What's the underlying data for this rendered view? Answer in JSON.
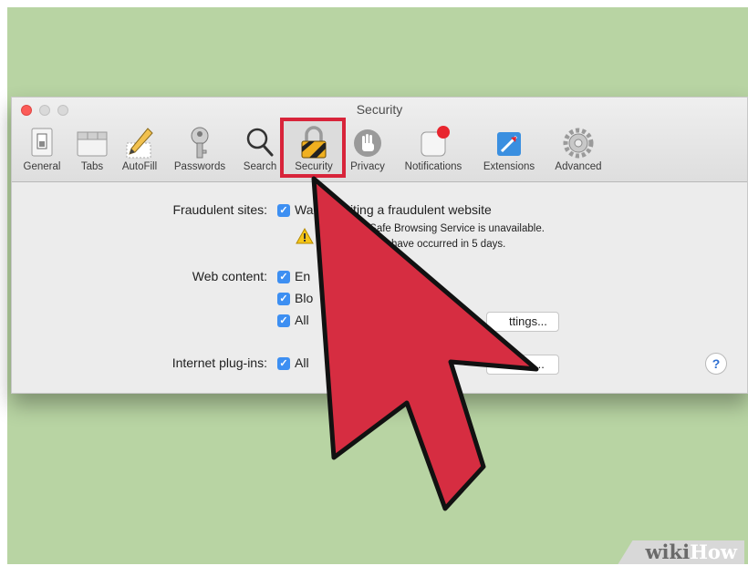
{
  "window": {
    "title": "Security"
  },
  "toolbar": {
    "items": [
      {
        "label": "General",
        "icon": "general-switch-icon"
      },
      {
        "label": "Tabs",
        "icon": "tabs-icon"
      },
      {
        "label": "AutoFill",
        "icon": "pencil-icon"
      },
      {
        "label": "Passwords",
        "icon": "key-icon"
      },
      {
        "label": "Search",
        "icon": "magnifier-icon"
      },
      {
        "label": "Security",
        "icon": "lock-icon",
        "selected": true
      },
      {
        "label": "Privacy",
        "icon": "hand-icon"
      },
      {
        "label": "Notifications",
        "icon": "notifications-icon"
      },
      {
        "label": "Extensions",
        "icon": "puzzle-icon"
      },
      {
        "label": "Advanced",
        "icon": "gear-icon"
      }
    ]
  },
  "fraud": {
    "label": "Fraudulent sites:",
    "option": "Wa   en visiting a fraudulent website",
    "note1": "le Safe Browsing Service is unavailable.",
    "note2": "have occurred in 5 days."
  },
  "web": {
    "label": "Web content:",
    "opt1": "En",
    "opt2": "Blo",
    "opt3": "All",
    "button": "ttings..."
  },
  "plugins": {
    "label": "Internet plug-ins:",
    "opt": "All",
    "button": "..."
  },
  "help": {
    "label": "?"
  },
  "watermark": {
    "prefix": "wiki",
    "suffix": "How"
  },
  "colors": {
    "highlight": "#d8243a",
    "arrow": "#d62d41",
    "background": "#b8d4a3",
    "checkbox": "#3d8ff2"
  }
}
